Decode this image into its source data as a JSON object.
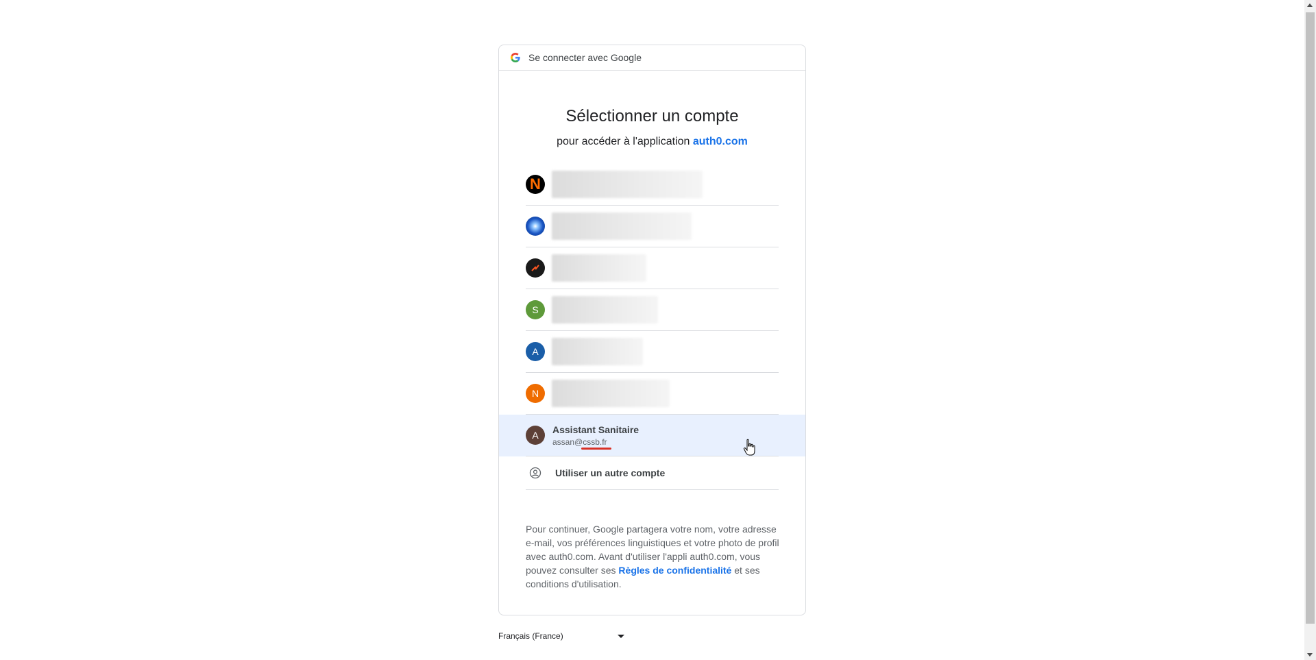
{
  "header": {
    "title": "Se connecter avec Google"
  },
  "main": {
    "title": "Sélectionner un compte",
    "subtitle_prefix": "pour accéder à l'application",
    "app_link": "auth0.com"
  },
  "accounts": [
    {
      "avatar": "N",
      "avatar_color": "#000000",
      "avatar_fg": "#ff6d00",
      "blurred": true
    },
    {
      "avatar": "",
      "avatar_color": "#1a56c4",
      "blurred": true
    },
    {
      "avatar": "",
      "avatar_color": "#1a1a1a",
      "blurred": true
    },
    {
      "avatar": "S",
      "avatar_color": "#5e9a3a",
      "blurred": true
    },
    {
      "avatar": "A",
      "avatar_color": "#1a5ea8",
      "blurred": true
    },
    {
      "avatar": "N",
      "avatar_color": "#ef6c00",
      "blurred": true
    },
    {
      "avatar": "A",
      "avatar_color": "#5d4037",
      "name": "Assistant Sanitaire",
      "email": "assan@cssb.fr",
      "selected": true
    }
  ],
  "other_account": {
    "label": "Utiliser un autre compte",
    "icon": "account-circle-icon"
  },
  "info": {
    "text_before": "Pour continuer, Google partagera votre nom, votre adresse e-mail, vos préférences linguistiques et votre photo de profil avec auth0.com. Avant d'utiliser l'appli auth0.com, vous pouvez consulter ses",
    "privacy_link": "Règles de confidentialité",
    "text_after": "et ses conditions d'utilisation."
  },
  "language": {
    "selected": "Français (France)"
  }
}
